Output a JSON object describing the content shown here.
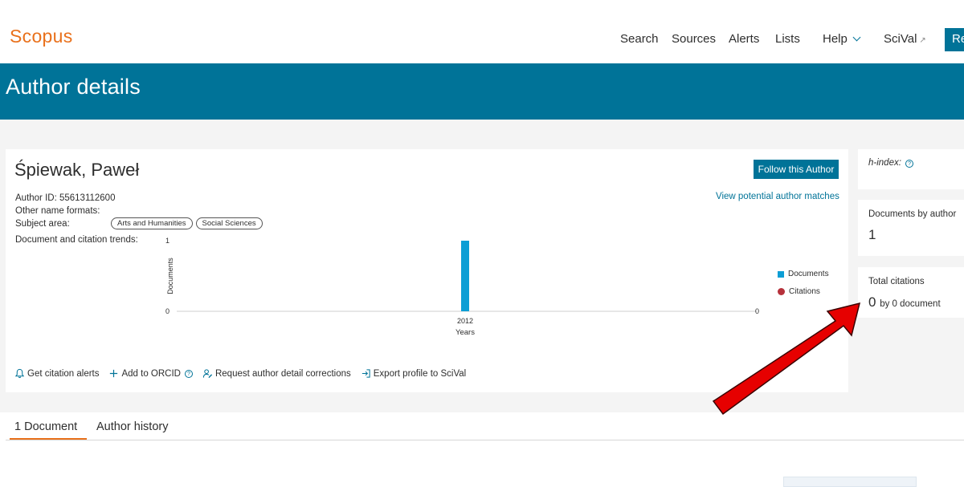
{
  "header": {
    "logo": "Scopus",
    "nav": {
      "search": "Search",
      "sources": "Sources",
      "alerts": "Alerts",
      "lists": "Lists",
      "help": "Help",
      "scival": "SciVal",
      "register": "Re"
    }
  },
  "banner": {
    "title": "Author details"
  },
  "author": {
    "name": "Śpiewak, Paweł",
    "follow_label": "Follow this Author",
    "view_matches": "View potential author matches",
    "id_line": "Author ID: 55613112600",
    "other_names_line": "Other name formats:",
    "subject_label": "Subject area:",
    "subjects": [
      "Arts and Humanities",
      "Social Sciences"
    ],
    "trends_label": "Document and citation trends:"
  },
  "chart_data": {
    "type": "bar",
    "categories": [
      "2012"
    ],
    "series": [
      {
        "name": "Documents",
        "values": [
          1
        ]
      },
      {
        "name": "Citations",
        "values": [
          0
        ]
      }
    ],
    "xlabel": "Years",
    "ylabel": "Documents",
    "ylabel_right": "Citations",
    "ylim": [
      0,
      1
    ],
    "ylim_right": [
      0,
      0
    ],
    "y_ticks": [
      "1",
      "0"
    ],
    "y_ticks_right": [
      "0"
    ],
    "legend_position": "right",
    "colors": {
      "documents": "#0c9ed5",
      "citations": "#b6313b"
    }
  },
  "actions": {
    "citation_alerts": "Get citation alerts",
    "add_orcid": "Add to ORCID",
    "request_corrections": "Request author detail corrections",
    "export_scival": "Export profile to SciVal"
  },
  "metrics": {
    "h_index_label": "h-index:",
    "documents_label": "Documents by author",
    "documents_value": "1",
    "citations_label": "Total citations",
    "citations_value": "0",
    "citations_suffix": "by 0 document"
  },
  "tabs": {
    "documents": "1 Document",
    "history": "Author history"
  },
  "colors": {
    "brand_orange": "#e9711c",
    "brand_blue": "#007398",
    "arrow_red": "#e60000"
  }
}
